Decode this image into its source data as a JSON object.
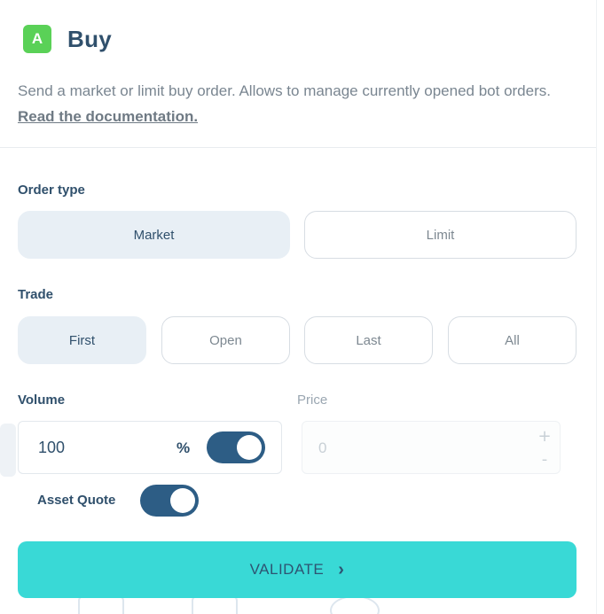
{
  "header": {
    "badge": "A",
    "title": "Buy"
  },
  "description": {
    "text": "Send a market or limit buy order. Allows to manage currently opened bot orders. ",
    "link": "Read the documentation."
  },
  "order_type": {
    "label": "Order type",
    "options": [
      "Market",
      "Limit"
    ],
    "selected": "Market"
  },
  "trade": {
    "label": "Trade",
    "options": [
      "First",
      "Open",
      "Last",
      "All"
    ],
    "selected": "First"
  },
  "volume": {
    "label": "Volume",
    "value": "100",
    "unit": "%",
    "percent_toggle_on": true
  },
  "price": {
    "label": "Price",
    "placeholder": "0",
    "plus": "+",
    "minus": "-"
  },
  "asset_quote": {
    "label": "Asset Quote",
    "toggle_on": true
  },
  "validate": {
    "label": "VALIDATE",
    "icon": "chevron-right-icon"
  },
  "colors": {
    "badge": "#5ad157",
    "title": "#30506c",
    "active_bg": "#e8eff5",
    "toggle_on": "#2d5d85",
    "validate_bg": "#39d9d6"
  }
}
